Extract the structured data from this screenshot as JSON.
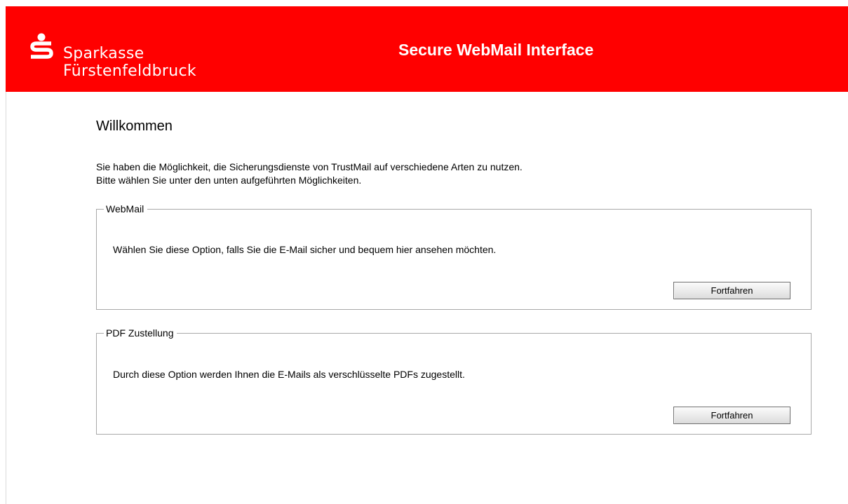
{
  "header": {
    "brand_line1": "Sparkasse",
    "brand_line2": "Fürstenfeldbruck",
    "title": "Secure WebMail Interface",
    "logo_icon": "sparkasse-s-icon",
    "background_color": "#ff0000",
    "text_color": "#ffffff"
  },
  "main": {
    "heading": "Willkommen",
    "intro_line1": "Sie haben die Möglichkeit, die Sicherungsdienste von TrustMail auf verschiedene Arten zu nutzen.",
    "intro_line2": "Bitte wählen Sie unter den unten aufgeführten Möglichkeiten.",
    "options": [
      {
        "legend": "WebMail",
        "description": "Wählen Sie diese Option, falls Sie die E-Mail sicher und bequem hier ansehen möchten.",
        "button_label": "Fortfahren"
      },
      {
        "legend": "PDF Zustellung",
        "description": "Durch diese Option werden Ihnen die E-Mails als verschlüsselte PDFs zugestellt.",
        "button_label": "Fortfahren"
      }
    ]
  }
}
